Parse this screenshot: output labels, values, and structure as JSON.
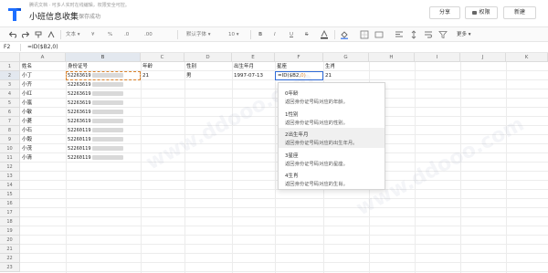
{
  "header": {
    "subtitle": "腾讯文档 · 可多人实时在线编辑，权限安全可控。",
    "title": "小班信息收集",
    "save_status": "保存成功",
    "share_label": "分享",
    "permission_label": "权限",
    "new_label": "新建"
  },
  "toolbar": {
    "font_label": "文本",
    "currency": "¥",
    "percent": "%",
    "decimal_label": ".0",
    "default_font": "默认字体",
    "font_size": "10",
    "bold": "B",
    "italic": "I",
    "underline": "U",
    "strike": "S",
    "more_label": "更多"
  },
  "formula_bar": {
    "cell_ref": "F2",
    "formula": "=ID($B2,0)"
  },
  "grid": {
    "columns": [
      "A",
      "B",
      "C",
      "D",
      "E",
      "F",
      "G",
      "H",
      "I",
      "J",
      "K"
    ],
    "rows": [
      "1",
      "2",
      "3",
      "4",
      "5",
      "6",
      "7",
      "8",
      "9",
      "10",
      "11",
      "12",
      "13",
      "14",
      "15",
      "16",
      "17",
      "18",
      "19",
      "20",
      "21",
      "22",
      "23"
    ],
    "header_row": [
      "姓名",
      "身份证号",
      "年龄",
      "性别",
      "出生年月",
      "星座",
      "生肖"
    ],
    "names": [
      "小丁",
      "小齐",
      "小红",
      "小嵐",
      "小敏",
      "小菱",
      "小石",
      "小毅",
      "小茂",
      "小清"
    ],
    "id_prefixes": [
      "52263619",
      "52263619",
      "52263619",
      "52263619",
      "52263619",
      "52263619",
      "52260119",
      "52260119",
      "52260119",
      "52260119"
    ],
    "row2": {
      "age": "21",
      "gender": "男",
      "birth": "1997-07-13",
      "editing": "=ID($B2,",
      "editing_arg": "0)",
      "zodiac": "21"
    }
  },
  "popup": {
    "options": [
      {
        "title": "0年龄",
        "desc": "返回身份证号码对应的年龄。"
      },
      {
        "title": "1性别",
        "desc": "返回身份证号码对应的性别。"
      },
      {
        "title": "2出生年月",
        "desc": "返回身份证号码对应的出生年月。"
      },
      {
        "title": "3星座",
        "desc": "返回身份证号码对应的星座。"
      },
      {
        "title": "4生肖",
        "desc": "返回身份证号码对应的生肖。"
      }
    ],
    "highlighted_index": 2
  },
  "watermark": "www.ddooo.com"
}
